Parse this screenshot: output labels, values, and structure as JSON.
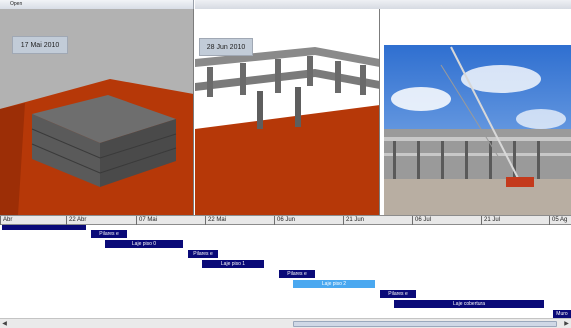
{
  "windows": {
    "left_title": "Open",
    "right_title": ""
  },
  "panels": {
    "model_1_date": "17 Mai 2010",
    "model_2_date": "28 Jun 2010"
  },
  "timeline": {
    "labels": [
      "Abr",
      "22 Abr",
      "07 Mai",
      "22 Mai",
      "06 Jun",
      "21 Jun",
      "06 Jul",
      "21 Jul",
      "05 Ag"
    ]
  },
  "tasks": [
    {
      "label": "",
      "color": "#0a0a78"
    },
    {
      "label": "Pilares e",
      "color": "#0a0a78"
    },
    {
      "label": "Laje piso 0",
      "color": "#0a0a78"
    },
    {
      "label": "Pilares e",
      "color": "#0a0a78"
    },
    {
      "label": "Laje piso 1",
      "color": "#0a0a78"
    },
    {
      "label": "Pilares e",
      "color": "#0a0a78"
    },
    {
      "label": "Laje piso 2",
      "color": "#4aa8f0",
      "selected": true
    },
    {
      "label": "Pilares e",
      "color": "#0a0a78"
    },
    {
      "label": "Laje cobertura",
      "color": "#0a0a78"
    },
    {
      "label": "Muro",
      "color": "#0a0a78"
    }
  ],
  "colors": {
    "task_bar": "#0a0a78",
    "selected_task": "#4aa8f0",
    "ground": "#b63808"
  }
}
